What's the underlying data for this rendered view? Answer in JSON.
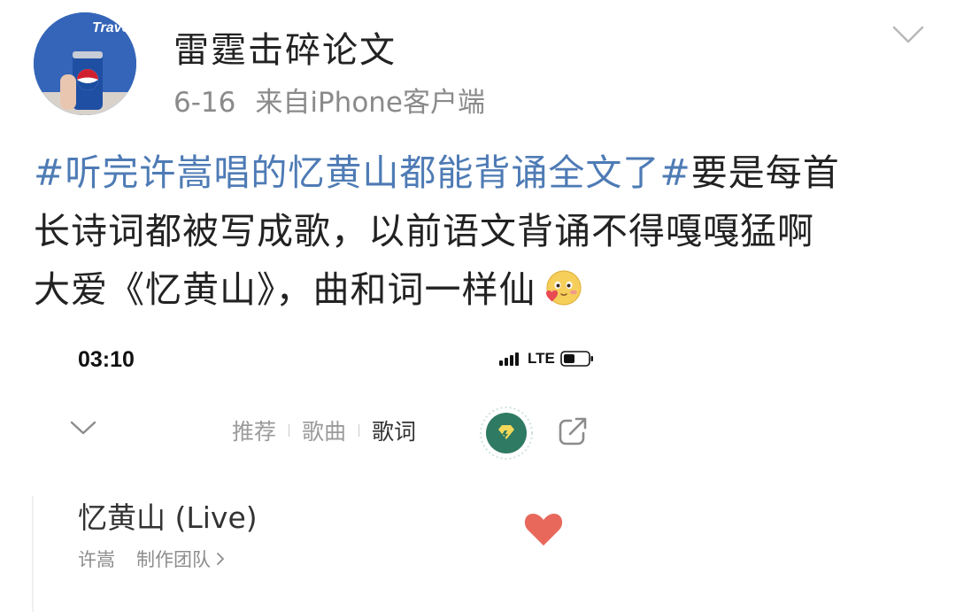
{
  "post": {
    "username": "雷霆击碎论文",
    "time": "6-16",
    "source": "来自iPhone客户端",
    "avatar": {
      "shirt_text": "Travel",
      "can_brand": "pepsi"
    },
    "text": {
      "line1": {
        "hashtag": "#听完许嵩唱的忆黄山都能背诵全文了#",
        "rest": "要是每首"
      },
      "line2": "长诗词都被写成歌，以前语文背诵不得嘎嘎猛啊",
      "line3": "大爱《忆黄山》，曲和词一样仙"
    },
    "emoji_icon": "blushing-heart-emoji-icon"
  },
  "phone": {
    "status_time": "03:10",
    "network": "LTE",
    "tabs": [
      {
        "label": "推荐",
        "active": false
      },
      {
        "label": "歌曲",
        "active": false
      },
      {
        "label": "歌词",
        "active": true
      }
    ],
    "song_title": "忆黄山 (Live)",
    "artist": "许嵩",
    "team_label": "制作团队"
  },
  "colors": {
    "hashtag": "#4e7bb5",
    "heart": "#e8685c",
    "badge_green": "#2f7a63",
    "badge_yellow": "#f3d85a"
  }
}
